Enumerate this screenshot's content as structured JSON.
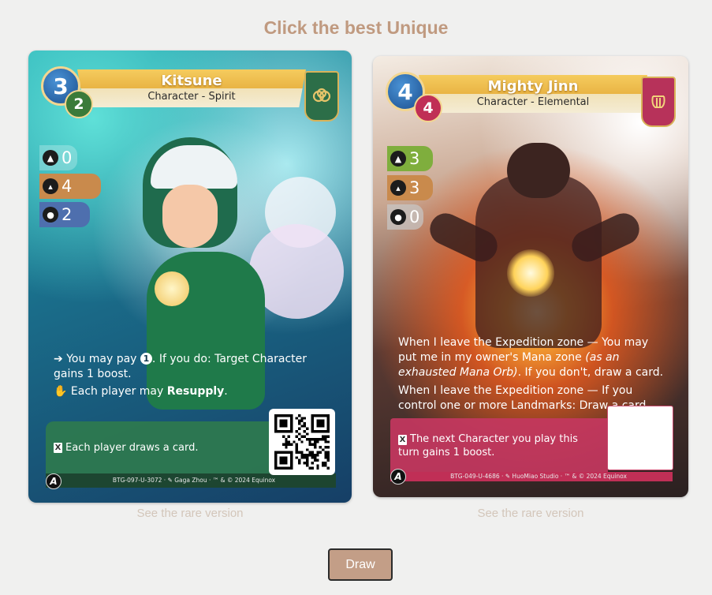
{
  "prompt": {
    "title": "Click the best Unique"
  },
  "cards": [
    {
      "name": "Kitsune",
      "type": "Character - Spirit",
      "cost_main": "3",
      "cost_recall": "2",
      "faction_icon": "knot-emblem-icon",
      "stats": {
        "forest": "0",
        "mountain": "4",
        "water": "2"
      },
      "ability1_pre": "You may pay ",
      "ability1_cost": "1",
      "ability1_post": ". If you do: Target Character gains 1 boost.",
      "ability2_pre": "Each player may ",
      "ability2_bold": "Resupply",
      "ability2_post": ".",
      "reserve_glyph": "X",
      "reserve_text": "Each player draws a card.",
      "footer": "BTG-097-U-3072 · ✎ Gaga Zhou · ™ & © 2024 Equinox",
      "rare_link": "See the rare version",
      "colors": {
        "box": "#2f7a4e",
        "subcost": "#3b7b3a",
        "faction": "#2c6e48"
      }
    },
    {
      "name": "Mighty Jinn",
      "type": "Character - Elemental",
      "cost_main": "4",
      "cost_recall": "4",
      "faction_icon": "lyre-emblem-icon",
      "stats": {
        "forest": "3",
        "mountain": "3",
        "water": "0"
      },
      "ability1_pre": "When I leave the Expedition zone — You may put me in my owner's Mana zone ",
      "ability1_italic": "(as an exhausted Mana Orb)",
      "ability1_post": ". If you don't, draw a card.",
      "ability2": "When I leave the Expedition zone — If you control one or more Landmarks: Draw a card.",
      "reserve_glyph": "X",
      "reserve_text": "The next Character you play this turn gains 1 boost.",
      "footer": "BTG-049-U-4686 · ✎ HuoMiao Studio · ™ & © 2024 Equinox",
      "rare_link": "See the rare version",
      "colors": {
        "box": "#c4375f",
        "subcost": "#c02f56",
        "faction": "#b7325a"
      }
    }
  ],
  "actions": {
    "draw_label": "Draw"
  }
}
